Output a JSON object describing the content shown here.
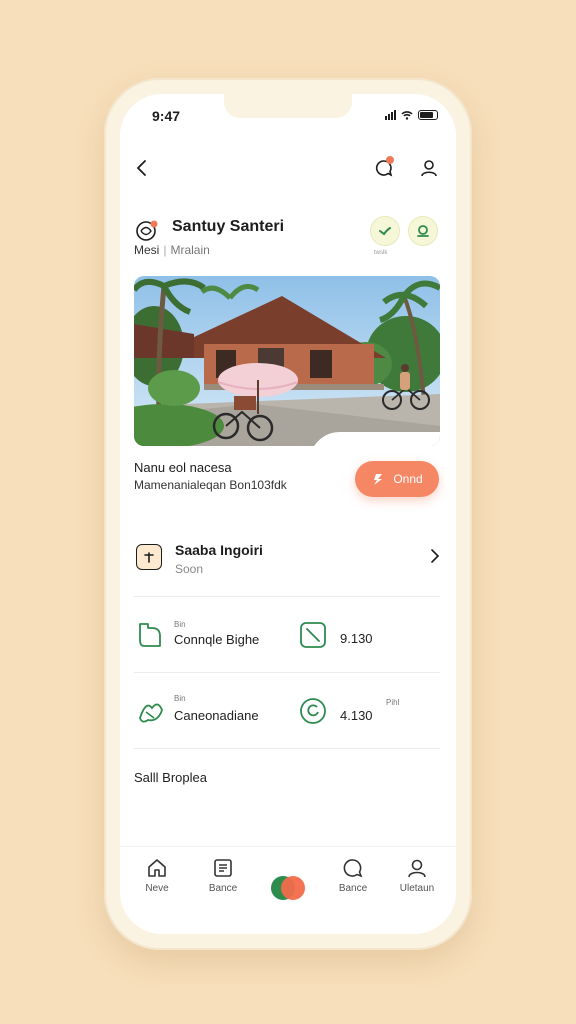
{
  "status": {
    "time": "9:47"
  },
  "header": {
    "back_icon": "chevron-left-icon",
    "notify_icon": "chat-bubble-icon",
    "profile_icon": "user-icon",
    "accent": "#ef7a5a"
  },
  "profile": {
    "title": "Santuy Santeri",
    "subtitle_left": "Mesi",
    "subtitle_right": "Mralain",
    "action_label": "twslk",
    "brand_green": "#2e8b4e"
  },
  "event": {
    "title": "Nanu eol nacesa",
    "subtitle": "Mamenanialeqan Bon103fdk",
    "cta_label": "Onnd",
    "cta_color": "#f58765"
  },
  "list_item": {
    "title": "Saaba Ingoiri",
    "subtitle": "Soon"
  },
  "stats": [
    {
      "small": "Bin",
      "label": "Connqle Bighe",
      "value": "9.130"
    },
    {
      "small": "Bin",
      "label": "Caneonadiane",
      "value": "4.130",
      "value_small": "Pihl"
    }
  ],
  "section": {
    "title": "Salll Broplea"
  },
  "tabbar": {
    "tabs": [
      {
        "label": "Neve",
        "icon": "home-icon"
      },
      {
        "label": "Bance",
        "icon": "document-icon"
      },
      {
        "label": "Bance",
        "icon": "chat-icon"
      },
      {
        "label": "Uletaun",
        "icon": "user-icon"
      }
    ]
  }
}
